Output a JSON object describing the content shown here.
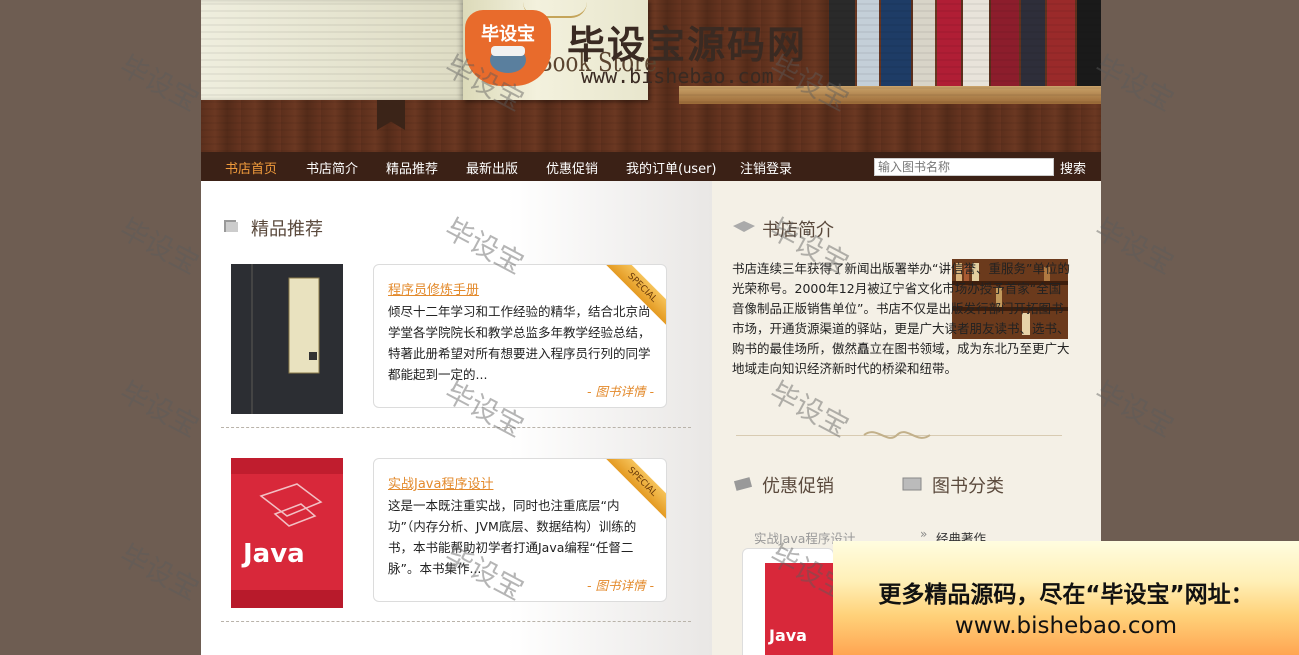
{
  "header": {
    "book_title": "Book Store",
    "logo_badge": "毕设宝",
    "logo_name": "毕设宝源码网",
    "logo_url": "www.bishebao.com"
  },
  "nav": {
    "items": [
      "书店首页",
      "书店简介",
      "精品推荐",
      "最新出版",
      "优惠促销",
      "我的订单(user)",
      "注销登录"
    ],
    "active_index": 0,
    "search_placeholder": "输入图书名称",
    "search_button": "搜索"
  },
  "featured": {
    "title": "精品推荐",
    "ribbon": "SPECIAL",
    "books": [
      {
        "title": "程序员修炼手册",
        "desc": "倾尽十二年学习和工作经验的精华，结合北京尚学堂各学院院长和教学总监多年教学经验总结，特著此册希望对所有想要进入程序员行列的同学都能起到一定的...",
        "link": "- 图书详情 -"
      },
      {
        "title": "实战Java程序设计",
        "desc": "这是一本既注重实战，同时也注重底层“内功”（内存分析、JVM底层、数据结构）训练的书，本书能帮助初学者打通Java编程“任督二脉”。本书集作...",
        "link": "- 图书详情 -"
      }
    ]
  },
  "about": {
    "title": "书店简介",
    "text": "书店连续三年获得了新闻出版署举办“讲信誉、重服务”单位的光荣称号。2000年12月被辽宁省文化市场办授予首家“全国音像制品正版销售单位”。书店不仅是出版发行部门开拓图书市场，开通货源渠道的驿站，更是广大读者朋友读书、选书、购书的最佳场所，傲然矗立在图书领域，成为东北乃至更广大地域走向知识经济新时代的桥梁和纽带。"
  },
  "promo": {
    "title": "优惠促销",
    "item": "实战Java程序设计"
  },
  "category": {
    "title": "图书分类",
    "item": "经典著作"
  },
  "watermark": "毕设宝",
  "ad": {
    "line1": "更多精品源码，尽在“毕设宝”网址：",
    "line2": "www.bishebao.com"
  },
  "colors": {
    "accent": "#e38a2c",
    "nav_bg": "#3b2116",
    "body_bg": "#6e5d52"
  }
}
